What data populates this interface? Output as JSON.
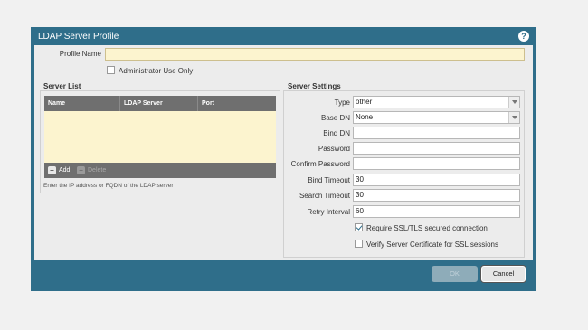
{
  "dialog": {
    "title": "LDAP Server Profile",
    "help_icon": "?"
  },
  "profile": {
    "name_label": "Profile Name",
    "name_value": "",
    "admin_use_only_label": "Administrator Use Only",
    "admin_use_only_checked": false
  },
  "server_list": {
    "title": "Server List",
    "columns": [
      "Name",
      "LDAP Server",
      "Port"
    ],
    "rows": [],
    "add_label": "Add",
    "delete_label": "Delete",
    "hint": "Enter the IP address or FQDN of the LDAP server"
  },
  "server_settings": {
    "title": "Server Settings",
    "type_label": "Type",
    "type_value": "other",
    "base_dn_label": "Base DN",
    "base_dn_value": "None",
    "bind_dn_label": "Bind DN",
    "bind_dn_value": "",
    "password_label": "Password",
    "confirm_password_label": "Confirm Password",
    "bind_timeout_label": "Bind Timeout",
    "bind_timeout_value": "30",
    "search_timeout_label": "Search Timeout",
    "search_timeout_value": "30",
    "retry_interval_label": "Retry Interval",
    "retry_interval_value": "60",
    "require_ssl_label": "Require SSL/TLS secured connection",
    "require_ssl_checked": true,
    "verify_cert_label": "Verify Server Certificate for SSL sessions",
    "verify_cert_checked": false
  },
  "footer": {
    "ok_label": "OK",
    "cancel_label": "Cancel"
  },
  "colors": {
    "frame": "#2f6e8a",
    "panel": "#ececec",
    "highlight_field": "#fcf4cf",
    "grid_header": "#6f6f6f"
  }
}
